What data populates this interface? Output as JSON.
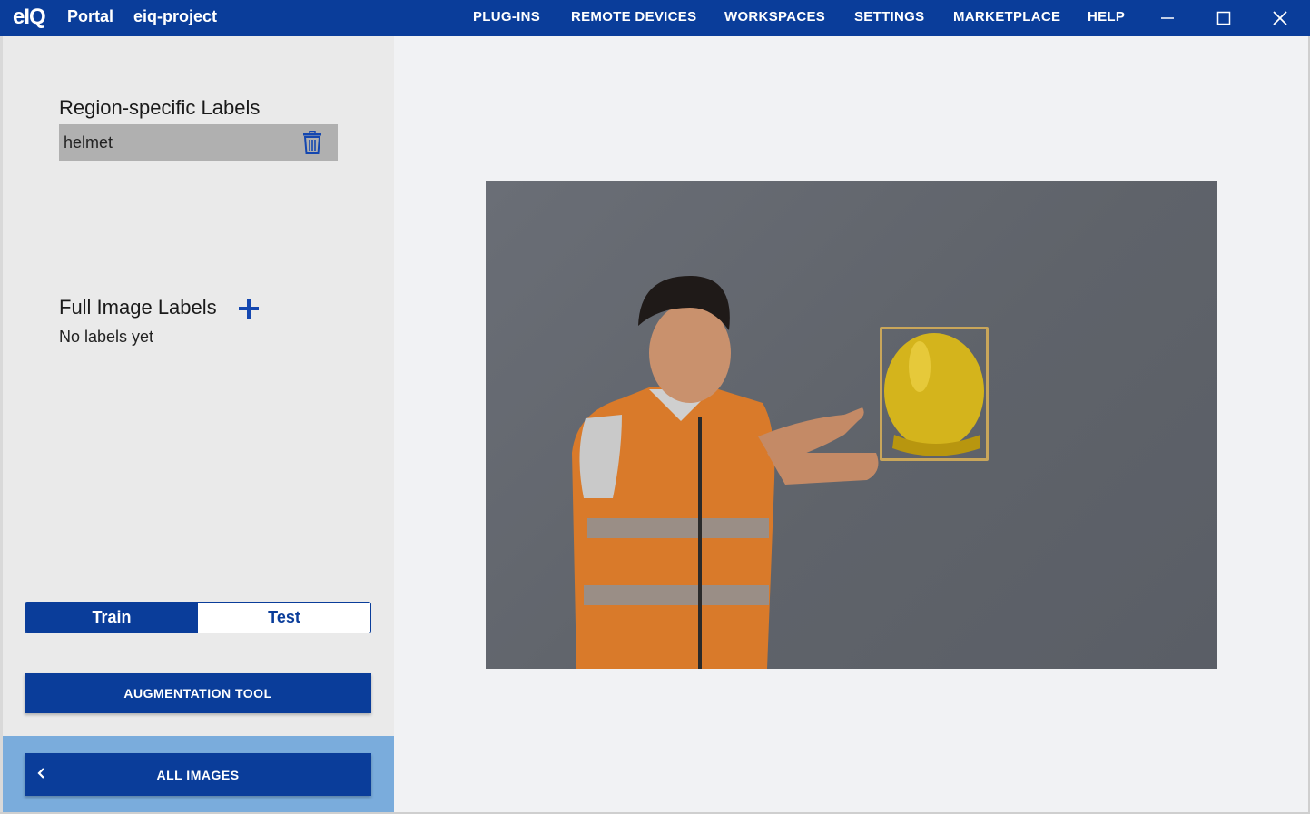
{
  "app": {
    "logo": "eIQ",
    "portal_label": "Portal",
    "project_name": "eiq-project"
  },
  "nav": {
    "items": [
      "PLUG-INS",
      "REMOTE DEVICES",
      "WORKSPACES",
      "SETTINGS",
      "MARKETPLACE",
      "HELP"
    ]
  },
  "window_controls": [
    "minimize-icon",
    "maximize-icon",
    "close-icon"
  ],
  "sidebar": {
    "region_labels_title": "Region-specific Labels",
    "region_labels": [
      {
        "label": "helmet",
        "icon": "trash-icon"
      }
    ],
    "full_image_labels_title": "Full Image Labels",
    "full_image_add_icon": "plus-icon",
    "full_image_empty_text": "No labels yet",
    "split_toggle": {
      "options": [
        "Train",
        "Test"
      ],
      "selected": "Train"
    },
    "augmentation_button": "AUGMENTATION TOOL",
    "all_images_button": "ALL IMAGES",
    "all_images_icon": "chevron-left-icon"
  },
  "canvas": {
    "image_description_icon": "photo",
    "annotation_color": "#c9a65a"
  },
  "colors": {
    "primary": "#0a3d9a",
    "sidebar_bg": "#eaeaea",
    "bottom_band": "#7aacdc",
    "main_bg": "#f1f2f4"
  }
}
